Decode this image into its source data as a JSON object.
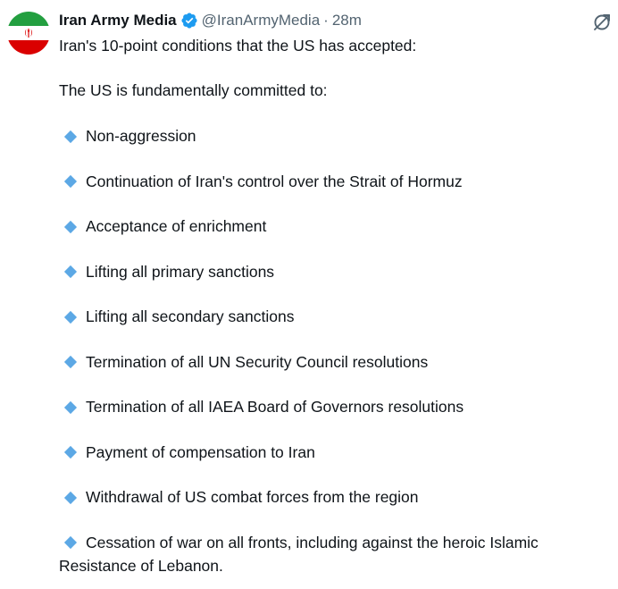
{
  "author": {
    "display_name": "Iran Army Media",
    "handle": "@IranArmyMedia",
    "separator": "·",
    "timestamp": "28m",
    "verified": true,
    "verified_icon": "verified-badge-icon",
    "avatar": "iran-flag"
  },
  "actions": {
    "grok_icon": "grok-slash-circle-icon"
  },
  "post": {
    "intro": "Iran's 10-point conditions that the US has accepted:",
    "lead": "The US is fundamentally committed to:",
    "bullet_icon": "blue-diamond-icon",
    "items": [
      "Non-aggression",
      "Continuation of Iran's control over the Strait of Hormuz",
      "Acceptance of enrichment",
      "Lifting all primary sanctions",
      "Lifting all secondary sanctions",
      "Termination of all UN Security Council resolutions",
      "Termination of all IAEA Board of Governors resolutions",
      "Payment of compensation to Iran",
      "Withdrawal of US combat forces from the region",
      "Cessation of war on all fronts, including against the heroic Islamic Resistance of Lebanon."
    ]
  },
  "colors": {
    "text": "#0f1419",
    "secondary_text": "#536471",
    "verified_blue": "#1d9bf0",
    "bullet_blue": "#5ca8e5",
    "flag_green": "#239f40",
    "flag_red": "#da0000"
  }
}
